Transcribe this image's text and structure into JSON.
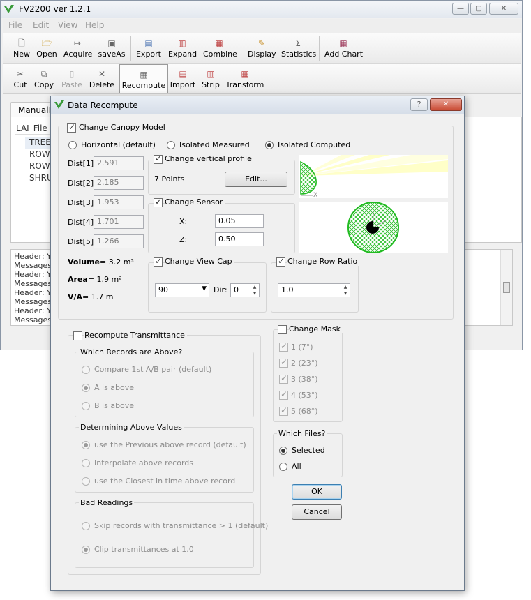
{
  "main_window": {
    "title": "FV2200 ver 1.2.1",
    "caption_buttons": {
      "minimize": "—",
      "maximize": "▢",
      "close": "✕"
    },
    "menu": [
      "File",
      "Edit",
      "View",
      "Help"
    ],
    "toolbar1": [
      {
        "label": "New",
        "icon": "new-file-icon"
      },
      {
        "label": "Open",
        "icon": "open-folder-icon"
      },
      {
        "label": "Acquire",
        "icon": "acquire-icon"
      },
      {
        "label": "saveAs",
        "icon": "save-icon"
      },
      {
        "label": "Export",
        "icon": "export-icon"
      },
      {
        "label": "Expand",
        "icon": "expand-icon"
      },
      {
        "label": "Combine",
        "icon": "combine-icon"
      },
      {
        "label": "Display",
        "icon": "display-icon"
      },
      {
        "label": "Statistics",
        "icon": "sigma-icon"
      },
      {
        "label": "Add Chart",
        "icon": "chart-icon"
      }
    ],
    "toolbar2": [
      {
        "label": "Cut",
        "icon": "scissors-icon"
      },
      {
        "label": "Copy",
        "icon": "copy-icon"
      },
      {
        "label": "Paste",
        "icon": "paste-icon"
      },
      {
        "label": "Delete",
        "icon": "delete-icon"
      },
      {
        "label": "Recompute",
        "icon": "recompute-icon"
      },
      {
        "label": "Import",
        "icon": "import-icon"
      },
      {
        "label": "Strip",
        "icon": "strip-icon"
      },
      {
        "label": "Transform",
        "icon": "transform-icon"
      }
    ],
    "tab_label": "ManualEx",
    "tree_header": "LAI_File",
    "tree_rows": [
      "TREE1",
      "ROW1",
      "ROW2",
      "SHRU"
    ],
    "log_rows": [
      "Header: Ye",
      "Messages",
      "Header: Ye",
      "Messages",
      "Header: Ye",
      "Messages",
      "Header: Ye",
      "Messages",
      "Header: Y"
    ]
  },
  "dialog": {
    "title": "Data Recompute",
    "help_button": "?",
    "close_button": "✕",
    "canopy": {
      "label": "Change Canopy Model",
      "checked": true,
      "models": [
        {
          "label": "Horizontal (default)",
          "selected": false
        },
        {
          "label": "Isolated Measured",
          "selected": false
        },
        {
          "label": "Isolated Computed",
          "selected": true
        }
      ],
      "dists": [
        {
          "label": "Dist[1]",
          "value": "2.591"
        },
        {
          "label": "Dist[2]",
          "value": "2.185"
        },
        {
          "label": "Dist[3]",
          "value": "1.953"
        },
        {
          "label": "Dist[4]",
          "value": "1.701"
        },
        {
          "label": "Dist[5]",
          "value": "1.266"
        }
      ],
      "vertical_profile": {
        "label": "Change vertical profile",
        "checked": true,
        "points": "7 Points",
        "edit_button": "Edit..."
      },
      "sensor": {
        "label": "Change Sensor",
        "checked": true,
        "x_label": "X:",
        "x_value": "0.05",
        "z_label": "Z:",
        "z_value": "0.50"
      },
      "volume": {
        "label": "Volume",
        "value": "= 3.2 m³"
      },
      "area": {
        "label": "Area",
        "value": "= 1.9 m²"
      },
      "va": {
        "label": "V/A",
        "value": "= 1.7 m"
      },
      "view_cap": {
        "label": "Change View Cap",
        "checked": true,
        "value": "90",
        "dir_label": "Dir:",
        "dir_value": "0"
      },
      "row_ratio": {
        "label": "Change Row Ratio",
        "checked": true,
        "value": "1.0"
      },
      "colors": {
        "crown_fill": "#00dd00",
        "sky_rays": "#ffffc8",
        "sensor": "#000000"
      }
    },
    "transmittance": {
      "label": "Recompute Transmittance",
      "checked": false,
      "above_group": {
        "title": "Which Records are Above?",
        "options": [
          {
            "label": "Compare 1st A/B pair (default)",
            "selected": false
          },
          {
            "label": "A is above",
            "selected": true
          },
          {
            "label": "B is above",
            "selected": false
          }
        ]
      },
      "values_group": {
        "title": "Determining Above Values",
        "options": [
          {
            "label": "use the Previous above record (default)",
            "selected": true
          },
          {
            "label": "Interpolate above records",
            "selected": false
          },
          {
            "label": "use the Closest in time above record",
            "selected": false
          }
        ]
      },
      "bad_group": {
        "title": "Bad Readings",
        "options": [
          {
            "label": "Skip records with transmittance > 1 (default)",
            "selected": false
          },
          {
            "label": "Clip transmittances at 1.0",
            "selected": true
          }
        ]
      }
    },
    "mask": {
      "label": "Change Mask",
      "checked": false,
      "rings": [
        {
          "label": "1 (7°)",
          "checked": true
        },
        {
          "label": "2 (23°)",
          "checked": true
        },
        {
          "label": "3 (38°)",
          "checked": true
        },
        {
          "label": "4 (53°)",
          "checked": true
        },
        {
          "label": "5 (68°)",
          "checked": true
        }
      ]
    },
    "files": {
      "title": "Which Files?",
      "options": [
        {
          "label": "Selected",
          "selected": true
        },
        {
          "label": "All",
          "selected": false
        }
      ]
    },
    "ok_button": "OK",
    "cancel_button": "Cancel"
  }
}
